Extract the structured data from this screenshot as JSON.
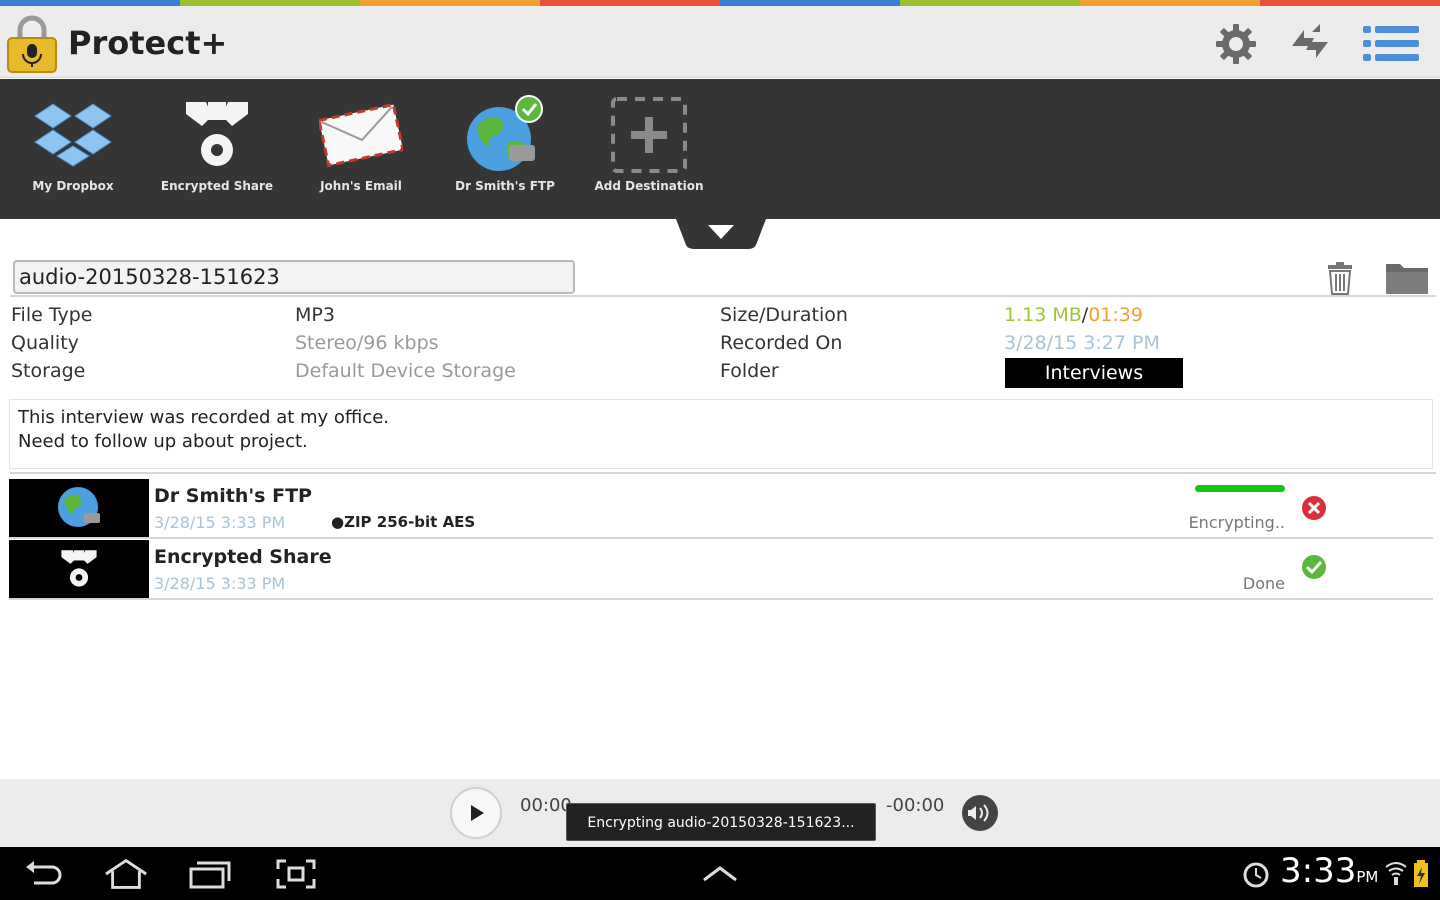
{
  "colors": {
    "strip": [
      "#3a7fd8",
      "#9ac230",
      "#f0a030",
      "#e8503a",
      "#3a7fd8",
      "#9ac230",
      "#f0a030",
      "#e8503a"
    ],
    "accent_green": "#9fc73a",
    "accent_orange": "#f0a030",
    "date_blue": "#a8c4da"
  },
  "header": {
    "title": "Protect+",
    "icons": [
      "lock-microphone-icon",
      "gear-icon",
      "sync-icon",
      "list-menu-icon"
    ]
  },
  "destinations": [
    {
      "label": "My Dropbox",
      "icon": "dropbox-icon"
    },
    {
      "label": "Encrypted Share",
      "icon": "encrypted-share-icon"
    },
    {
      "label": "John's Email",
      "icon": "email-envelope-icon"
    },
    {
      "label": "Dr Smith's FTP",
      "icon": "ftp-globe-icon"
    },
    {
      "label": "Add Destination",
      "icon": "add-icon"
    }
  ],
  "file": {
    "name": "audio-20150328-151623",
    "labels": {
      "file_type": "File Type",
      "quality": "Quality",
      "storage": "Storage",
      "size_duration": "Size/Duration",
      "recorded_on": "Recorded On",
      "folder": "Folder"
    },
    "values": {
      "file_type": "MP3",
      "quality": "Stereo/96 kbps",
      "storage": "Default Device Storage",
      "size": "1.13 MB",
      "separator": "/",
      "duration": "01:39",
      "recorded_on": "3/28/15 3:27 PM",
      "folder": "Interviews"
    },
    "notes_line1": "This interview was recorded at my office.",
    "notes_line2": "Need to follow up about project."
  },
  "uploads": [
    {
      "name": "Dr Smith's FTP",
      "date": "3/28/15 3:33 PM",
      "encryption": "●ZIP 256-bit AES",
      "status": "Encrypting..",
      "progress": 1.0,
      "state_icon": "cancel-icon"
    },
    {
      "name": "Encrypted Share",
      "date": "3/28/15 3:33 PM",
      "encryption": "",
      "status": "Done",
      "state_icon": "checkmark-icon"
    }
  ],
  "player": {
    "elapsed": "00:00",
    "remaining": "-00:00",
    "toast": "Encrypting audio-20150328-151623..."
  },
  "system": {
    "time": "3:33",
    "ampm": "PM"
  }
}
